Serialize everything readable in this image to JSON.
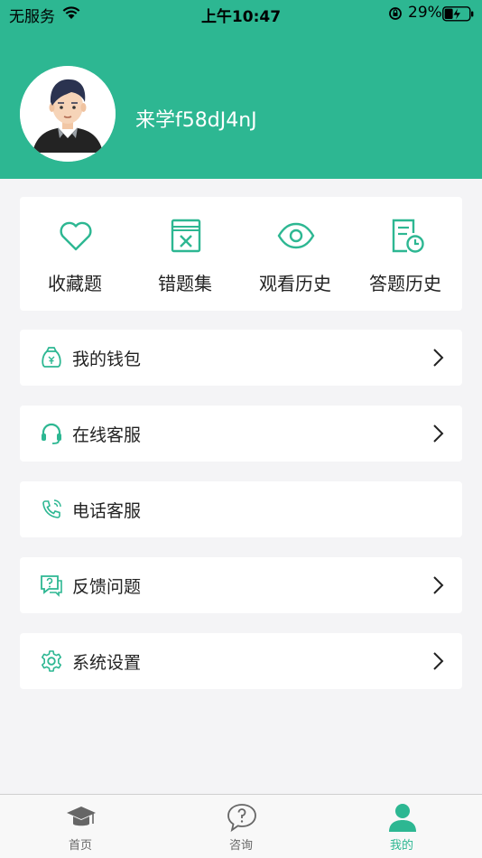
{
  "status_bar": {
    "carrier": "无服务",
    "time": "上午10:47",
    "battery": "29%"
  },
  "profile": {
    "username": "来学f58dJ4nJ"
  },
  "quick_actions": [
    {
      "label": "收藏题",
      "icon": "heart-icon"
    },
    {
      "label": "错题集",
      "icon": "wrong-book-icon"
    },
    {
      "label": "观看历史",
      "icon": "eye-icon"
    },
    {
      "label": "答题历史",
      "icon": "answer-history-icon"
    }
  ],
  "menu": [
    {
      "label": "我的钱包",
      "icon": "wallet-icon",
      "chevron": true
    },
    {
      "label": "在线客服",
      "icon": "headset-icon",
      "chevron": true
    },
    {
      "label": "电话客服",
      "icon": "phone-icon",
      "chevron": false
    },
    {
      "label": "反馈问题",
      "icon": "feedback-icon",
      "chevron": true
    },
    {
      "label": "系统设置",
      "icon": "settings-icon",
      "chevron": true
    }
  ],
  "tabbar": {
    "tabs": [
      {
        "label": "首页",
        "icon": "graduation-cap-icon",
        "active": false
      },
      {
        "label": "咨询",
        "icon": "question-bubble-icon",
        "active": false
      },
      {
        "label": "我的",
        "icon": "person-icon",
        "active": true
      }
    ]
  },
  "colors": {
    "accent": "#2db792",
    "background": "#f4f4f6"
  }
}
